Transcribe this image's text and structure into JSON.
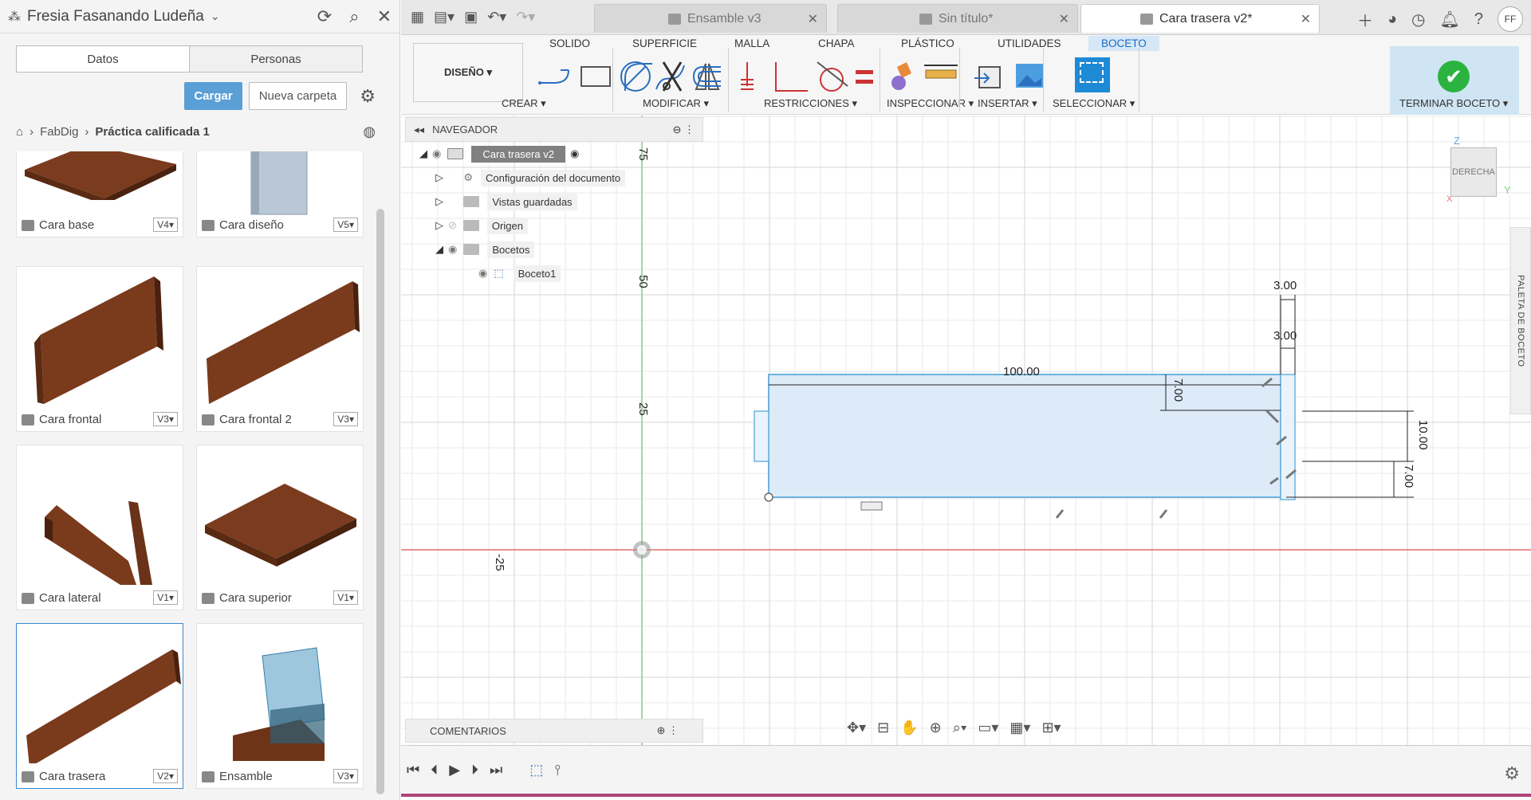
{
  "left_panel": {
    "user": "Fresia Fasanando Ludeña",
    "tabs": [
      "Datos",
      "Personas"
    ],
    "upload_label": "Cargar",
    "new_folder_label": "Nueva carpeta",
    "breadcrumb": [
      "FabDig",
      "Práctica calificada 1"
    ],
    "files": [
      {
        "name": "Cara base",
        "version": "V4▾"
      },
      {
        "name": "Cara diseño",
        "version": "V5▾"
      },
      {
        "name": "Cara frontal",
        "version": "V3▾"
      },
      {
        "name": "Cara frontal 2",
        "version": "V3▾"
      },
      {
        "name": "Cara lateral",
        "version": "V1▾"
      },
      {
        "name": "Cara superior",
        "version": "V1▾"
      },
      {
        "name": "Cara trasera",
        "version": "V2▾"
      },
      {
        "name": "Ensamble",
        "version": "V3▾"
      }
    ]
  },
  "doc_tabs": [
    "Ensamble v3",
    "Sin título*",
    "Cara trasera v2*"
  ],
  "avatar_initials": "FF",
  "ribbon": {
    "workspace": "DISEÑO ▾",
    "tabs": [
      "SOLIDO",
      "SUPERFICIE",
      "MALLA",
      "CHAPA",
      "PLÁSTICO",
      "UTILIDADES",
      "BOCETO"
    ],
    "groups": [
      "CREAR ▾",
      "MODIFICAR ▾",
      "RESTRICCIONES ▾",
      "INSPECCIONAR ▾",
      "INSERTAR ▾",
      "SELECCIONAR ▾",
      "TERMINAR BOCETO ▾"
    ]
  },
  "navigator": {
    "title": "NAVEGADOR",
    "root": "Cara trasera v2",
    "items": [
      "Configuración del documento",
      "Vistas guardadas",
      "Origen",
      "Bocetos",
      "Boceto1"
    ]
  },
  "comments_label": "COMENTARIOS",
  "view_cube_label": "DERECHA",
  "palette_label": "PALETA DE BOCETO",
  "axis_labels": {
    "z": "Z",
    "y": "Y",
    "x": "X"
  },
  "grid_labels": [
    "75",
    "50",
    "25",
    "-25"
  ],
  "dimensions": [
    "100.00",
    "7.00",
    "3.00",
    "3.00",
    "10.00",
    "7.00"
  ],
  "colors": {
    "accent": "#1b6bbf",
    "sketch_fill": "#dcebf7",
    "sketch_line": "#6bb2e0",
    "x_axis": "#e36b6b",
    "y_axis": "#7fd17f",
    "finish_green": "#2bb33f"
  }
}
